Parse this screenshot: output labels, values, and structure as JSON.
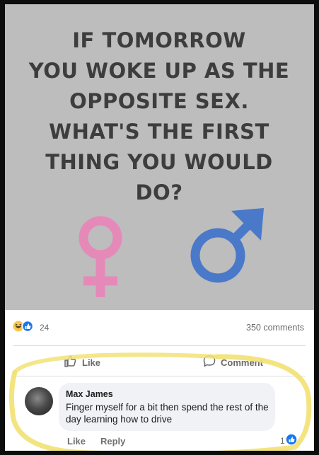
{
  "post": {
    "question": "IF TOMORROW\nYOU WOKE UP AS THE\nOPPOSITE SEX.\nWHAT'S THE FIRST\nTHING YOU WOULD\nDO?",
    "symbols": [
      "female-symbol-icon",
      "male-symbol-icon"
    ],
    "colors": {
      "poster_bg": "#bdbdbd",
      "female": "#e58ab8",
      "male": "#4a79c9",
      "highlight": "#f2e275"
    }
  },
  "stats": {
    "reactions_icons": [
      "haha-icon",
      "like-icon"
    ],
    "reaction_count": "24",
    "comments": "350 comments"
  },
  "actions": {
    "like_label": "Like",
    "comment_label": "Comment"
  },
  "comment": {
    "author": "Max James",
    "text": "Finger myself for a bit then spend the rest of the day learning how to drive",
    "like_label": "Like",
    "reply_label": "Reply",
    "reaction_count": "1"
  }
}
